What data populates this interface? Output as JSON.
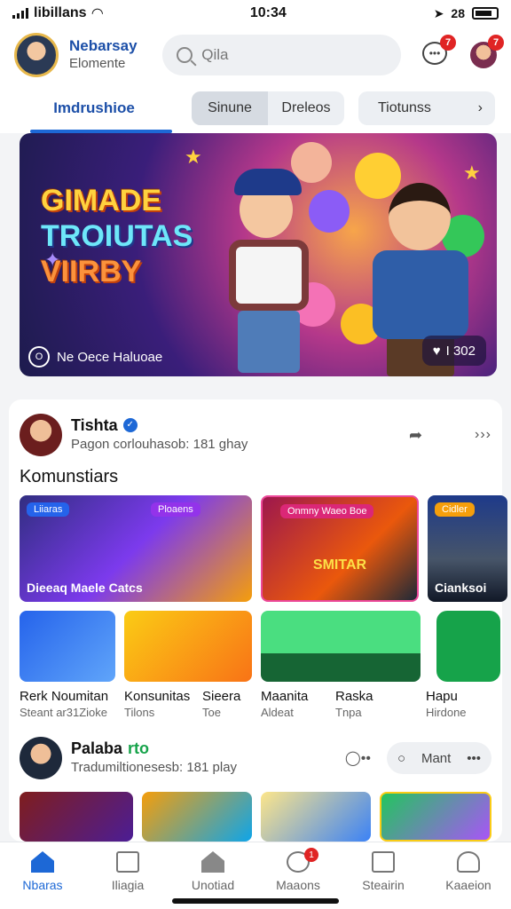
{
  "status_bar": {
    "carrier": "libillans",
    "time": "10:34",
    "right_text": "28"
  },
  "header": {
    "user_name": "Nebarsay",
    "user_subtitle": "Elomente",
    "search_placeholder": "Qila",
    "message_badge": "7",
    "profile_badge": "7"
  },
  "tabs": {
    "main_tab": "Imdrushioe",
    "segment": [
      "Sinune",
      "Dreleos"
    ],
    "more_pill": "Tiotunss"
  },
  "banner": {
    "title_lines": [
      "GIMADE",
      "TROIUTAS",
      "VIIRBY"
    ],
    "footer_text": "Ne Oece Haluoae",
    "like_count": "I 302"
  },
  "post1": {
    "name": "Tishta",
    "subtitle": "Pagon corlouhasob: 181 ghay",
    "section_title": "Komunstiars",
    "tiles_row1": [
      {
        "tag": "Liiaras",
        "tag2": "Ploaens",
        "caption": "Dieeaq Maele Catcs"
      },
      {
        "tag": "Onmny Waeo Boe",
        "caption": "SMITAR"
      },
      {
        "tag": "Cidler",
        "caption": "Cianksoi"
      }
    ],
    "tiles_row2_labels": [
      {
        "title": "Rerk Noumitan",
        "sub": "Steant ar31Zioke"
      },
      {
        "title": "Konsunitas",
        "sub": "Tilons"
      },
      {
        "title": "Sieera",
        "sub": "Toe"
      },
      {
        "title": "Maanita",
        "sub": "Aldeat"
      },
      {
        "title": "Raska",
        "sub": "Tnpa"
      },
      {
        "title": "Hapu",
        "sub": "Hirdone"
      }
    ]
  },
  "post2": {
    "name": "Palaba",
    "name_suffix": "rto",
    "subtitle": "Tradumiltionesesb: 181 play",
    "more_pill": "Mant"
  },
  "bottom_nav": [
    {
      "label": "Nbaras",
      "icon": "home-icon"
    },
    {
      "label": "Iliagia",
      "icon": "gallery-icon"
    },
    {
      "label": "Unotiad",
      "icon": "house-icon"
    },
    {
      "label": "Maaons",
      "icon": "refresh-icon",
      "badge": "1"
    },
    {
      "label": "Steairin",
      "icon": "list-icon"
    },
    {
      "label": "Kaaeion",
      "icon": "user-icon"
    }
  ],
  "colors": {
    "accent": "#1d68d6",
    "badge": "#e02424"
  }
}
